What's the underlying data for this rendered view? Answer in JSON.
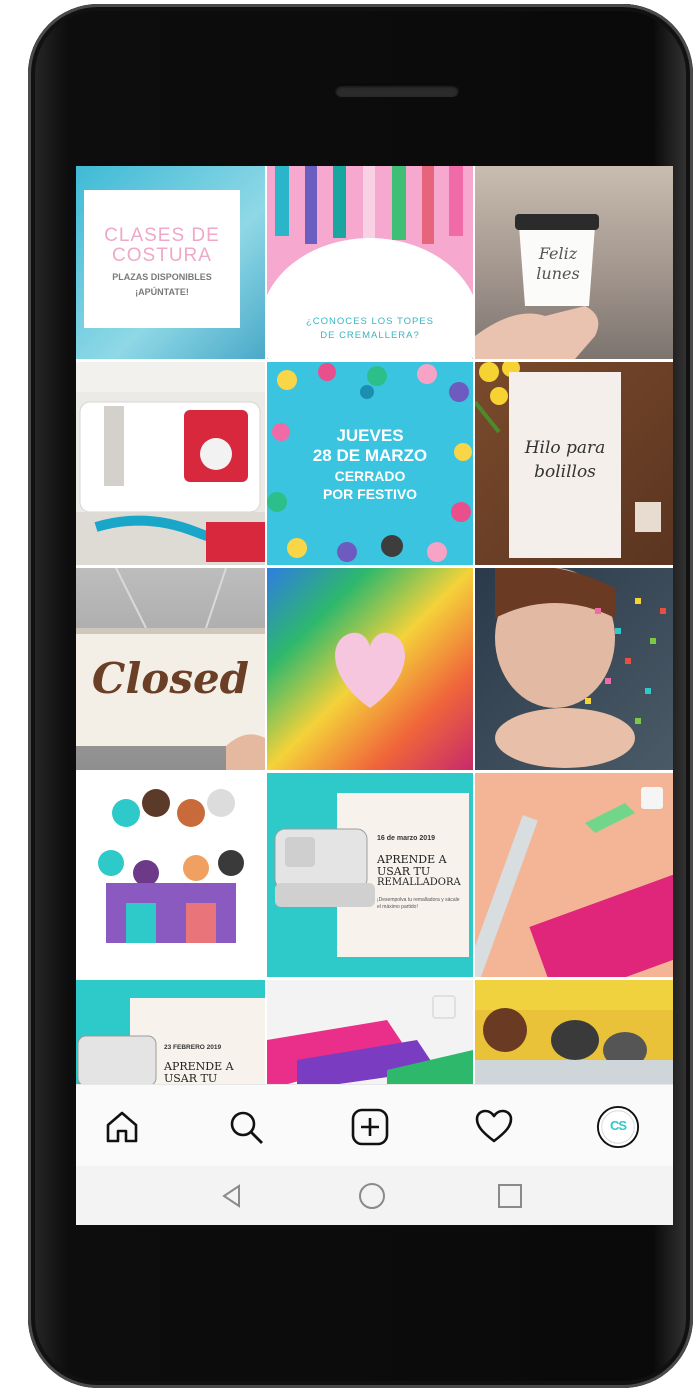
{
  "posts": {
    "p1": {
      "title": "CLASES DE COSTURA",
      "sub1": "PLAZAS DISPONIBLES",
      "sub2": "¡APÚNTATE!"
    },
    "p2": {
      "text1": "¿CONOCES LOS TOPES",
      "text2": "DE CREMALLERA?"
    },
    "p3": {
      "cup1": "Feliz",
      "cup2": "lunes"
    },
    "p4": {},
    "p5": {
      "l1": "JUEVES",
      "l2": "28 DE MARZO",
      "l3": "CERRADO",
      "l4": "POR FESTIVO"
    },
    "p6": {
      "l1": "Hilo para",
      "l2": "bolillos"
    },
    "p7": {
      "sign": "Closed"
    },
    "p8": {},
    "p9": {},
    "p10": {},
    "p11": {
      "date": "16 de marzo 2019",
      "h1": "APRENDE A",
      "h2": "USAR TU",
      "h3": "REMALLADORA",
      "small": "¡Desempolva tu remalladora y sácale el máximo partido!"
    },
    "p12": {},
    "p13": {
      "date": "23 FEBRERO 2019",
      "h1": "APRENDE A",
      "h2": "USAR TU"
    },
    "p14": {},
    "p15": {}
  },
  "nav": {
    "icons": [
      "home-icon",
      "search-icon",
      "add-post-icon",
      "heart-icon",
      "profile-avatar"
    ],
    "avatar_text": "CS"
  },
  "system_nav": [
    "back-icon",
    "home-circle-icon",
    "recents-icon"
  ],
  "colors": {
    "turquoise": "#2ec9c9",
    "pink": "#f6a8cf",
    "magenta": "#d6267a",
    "cream": "#f7f3ec",
    "brown": "#6b3f26"
  }
}
